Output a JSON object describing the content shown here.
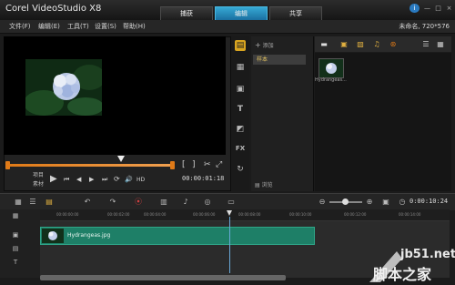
{
  "app": {
    "title": "Corel VideoStudio X8",
    "project_info": "未命名, 720*576"
  },
  "tabs": [
    {
      "label": "捕获"
    },
    {
      "label": "编辑"
    },
    {
      "label": "共享"
    }
  ],
  "window_controls": {
    "info": "i",
    "minimize": "—",
    "maximize": "□",
    "close": "×"
  },
  "menu": {
    "items": [
      "文件(F)",
      "编辑(E)",
      "工具(T)",
      "设置(S)",
      "帮助(H)"
    ]
  },
  "preview": {
    "mode_project": "项目",
    "mode_clip": "素材",
    "timecode": "00:00:01:18",
    "hd_label": "HD",
    "trim_in": "[",
    "trim_out": "]",
    "controls": {
      "play": "▶",
      "home": "⏮",
      "prev": "◀",
      "next": "▶",
      "end": "⏭",
      "repeat": "⟳",
      "volume": "🔊"
    }
  },
  "library": {
    "add_label": "添加",
    "folder_name": "样本",
    "browse_label": "浏览",
    "media_items": [
      {
        "name": "Hydrangeas..."
      }
    ]
  },
  "timeline": {
    "duration": "0:00:10:24",
    "ruler_ticks": [
      "00:00:00:00",
      "00:00:02:00",
      "00:00:04:00",
      "00:00:06:00",
      "00:00:08:00",
      "00:00:10:00",
      "00:00:12:00",
      "00:00:14:00"
    ],
    "clip": {
      "name": "Hydrangeas.jpg"
    }
  },
  "watermark": {
    "site": "jb51.net",
    "name": "脚本之家"
  },
  "colors": {
    "accent_tab": "#1a6fa0",
    "clip": "#1e7f67",
    "scrub": "#e07a17"
  }
}
